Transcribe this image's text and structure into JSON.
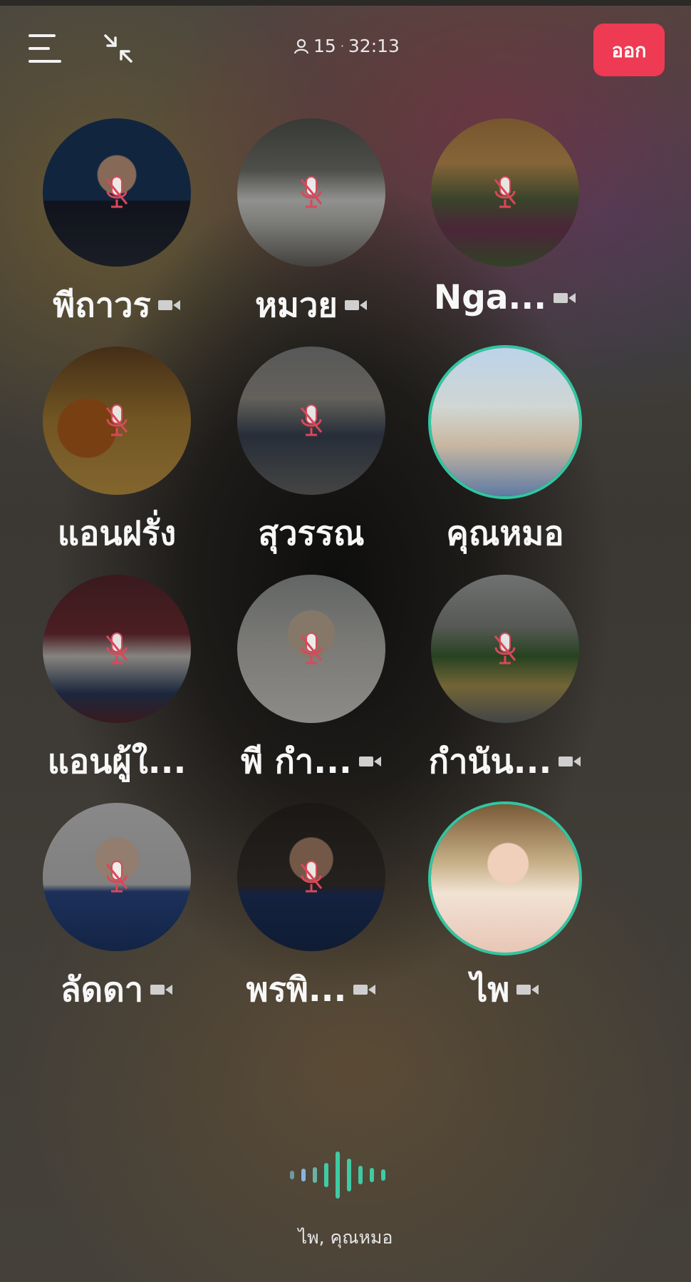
{
  "header": {
    "participant_count": "15",
    "duration": "32:13",
    "exit_label": "ออก"
  },
  "participants": [
    {
      "name": "พีถาวร",
      "camera_icon": true,
      "speaking": false,
      "photo": "man in dark suit, blue backdrop"
    },
    {
      "name": "หมวย",
      "camera_icon": true,
      "speaking": false,
      "photo": "woman beside white car"
    },
    {
      "name": "Nga...",
      "camera_icon": true,
      "speaking": false,
      "photo": "woman at sunset park"
    },
    {
      "name": "แอนฝรั่ง",
      "camera_icon": false,
      "speaking": false,
      "photo": "couple with flowers"
    },
    {
      "name": "สุวรรณ",
      "camera_icon": false,
      "speaking": false,
      "photo": "group on street"
    },
    {
      "name": "คุณหมอ",
      "camera_icon": false,
      "speaking": true,
      "photo": "man in blue cap and sunglasses"
    },
    {
      "name": "แอนผู้ใ...",
      "camera_icon": false,
      "speaking": false,
      "photo": "man standing in red room"
    },
    {
      "name": "พี กำ...",
      "camera_icon": true,
      "speaking": false,
      "photo": "woman with tiara"
    },
    {
      "name": "กำนัน...",
      "camera_icon": true,
      "speaking": false,
      "photo": "couple outdoors by building"
    },
    {
      "name": "ลัดดา",
      "camera_icon": true,
      "speaking": false,
      "photo": "woman in blue blazer"
    },
    {
      "name": "พรพิ...",
      "camera_icon": true,
      "speaking": false,
      "photo": "man in suit, dark background"
    },
    {
      "name": "ไพ",
      "camera_icon": true,
      "speaking": true,
      "photo": "woman with glasses, floral background"
    }
  ],
  "footer": {
    "active_speakers": "ไพ, คุณหมอ"
  },
  "colors": {
    "exit_button": "#ee3a52",
    "speaking_ring": "#32c5a0",
    "muted_mic": "#d9485a"
  },
  "icons": [
    "menu-icon",
    "collapse-icon",
    "person-icon",
    "muted-mic-icon",
    "camera-icon",
    "voice-wave-icon"
  ]
}
